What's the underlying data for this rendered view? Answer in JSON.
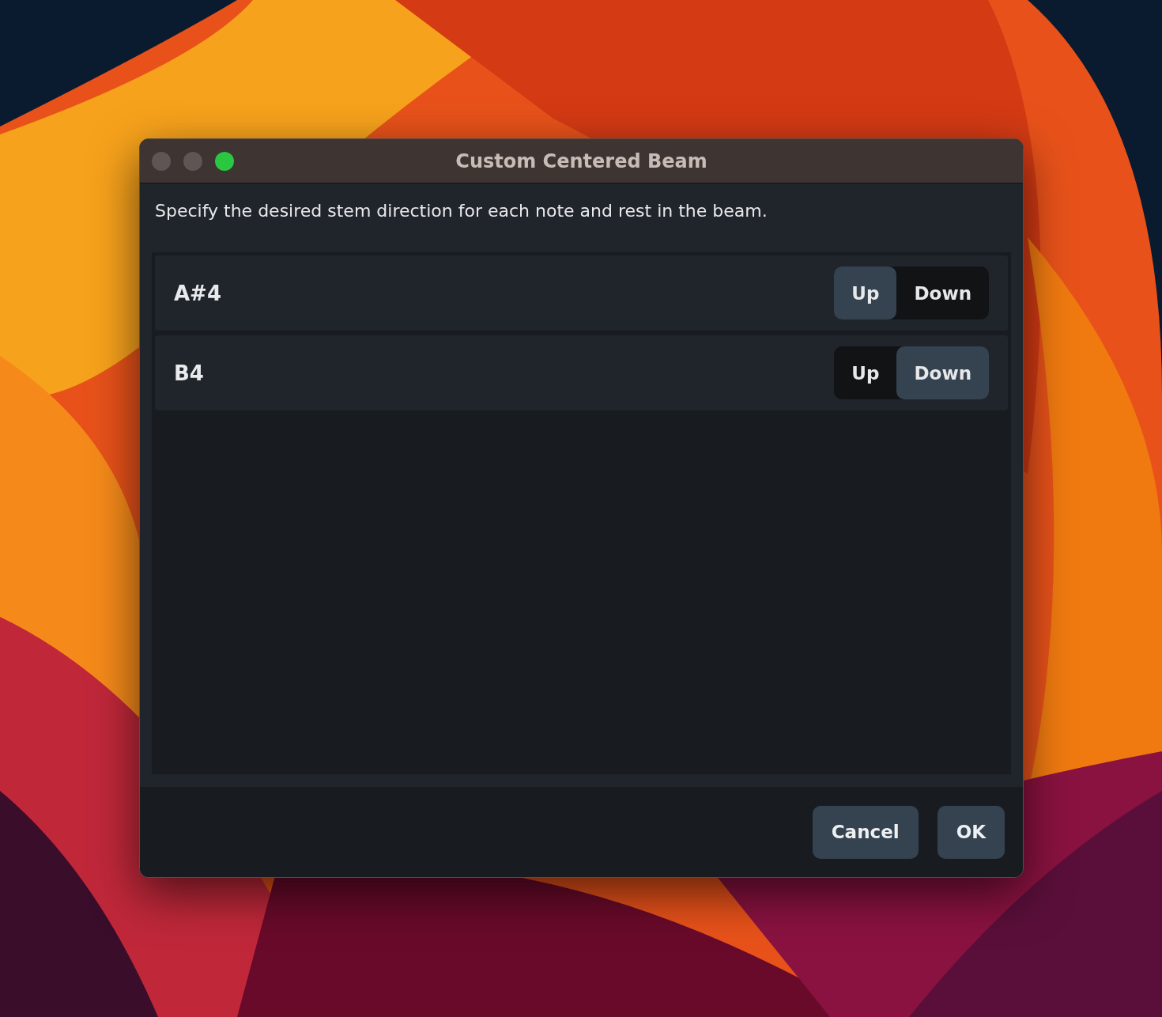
{
  "window": {
    "title": "Custom Centered Beam"
  },
  "description": "Specify the desired stem direction for each note and rest in the beam.",
  "notes": [
    {
      "label": "A#4",
      "options": [
        {
          "label": "Up",
          "selected": true
        },
        {
          "label": "Down",
          "selected": false
        }
      ]
    },
    {
      "label": "B4",
      "options": [
        {
          "label": "Up",
          "selected": false
        },
        {
          "label": "Down",
          "selected": true
        }
      ]
    }
  ],
  "buttons": [
    "Cancel",
    "OK"
  ]
}
